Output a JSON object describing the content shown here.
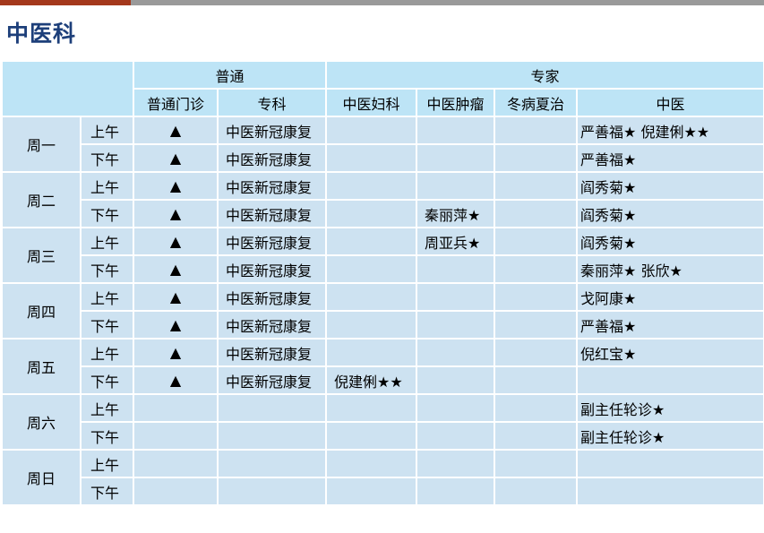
{
  "colors": {
    "accent": "#a4381c",
    "bar": "#9a9a9a",
    "title": "#1d3f7a",
    "header_bg": "#bde4f6",
    "cell_bg": "#cde2f1"
  },
  "title": "中医科",
  "headers": {
    "group_general": "普通",
    "group_expert": "专家",
    "columns": [
      "普通门诊",
      "专科",
      "中医妇科",
      "中医肿瘤",
      "冬病夏治",
      "中医"
    ]
  },
  "days": [
    {
      "name": "周一",
      "slots": [
        {
          "half": "上午",
          "general": "▲",
          "specialty": "中医新冠康复",
          "gyn": "",
          "oncology": "",
          "winter": "",
          "tcm": "严善福★  倪建俐★★"
        },
        {
          "half": "下午",
          "general": "▲",
          "specialty": "中医新冠康复",
          "gyn": "",
          "oncology": "",
          "winter": "",
          "tcm": "严善福★"
        }
      ]
    },
    {
      "name": "周二",
      "slots": [
        {
          "half": "上午",
          "general": "▲",
          "specialty": "中医新冠康复",
          "gyn": "",
          "oncology": "",
          "winter": "",
          "tcm": "阎秀菊★"
        },
        {
          "half": "下午",
          "general": "▲",
          "specialty": "中医新冠康复",
          "gyn": "",
          "oncology": "秦丽萍★",
          "winter": "",
          "tcm": "阎秀菊★"
        }
      ]
    },
    {
      "name": "周三",
      "slots": [
        {
          "half": "上午",
          "general": "▲",
          "specialty": "中医新冠康复",
          "gyn": "",
          "oncology": "周亚兵★",
          "winter": "",
          "tcm": "阎秀菊★"
        },
        {
          "half": "下午",
          "general": "▲",
          "specialty": "中医新冠康复",
          "gyn": "",
          "oncology": "",
          "winter": "",
          "tcm": "秦丽萍★  张欣★"
        }
      ]
    },
    {
      "name": "周四",
      "slots": [
        {
          "half": "上午",
          "general": "▲",
          "specialty": "中医新冠康复",
          "gyn": "",
          "oncology": "",
          "winter": "",
          "tcm": "戈阿康★"
        },
        {
          "half": "下午",
          "general": "▲",
          "specialty": "中医新冠康复",
          "gyn": "",
          "oncology": "",
          "winter": "",
          "tcm": "严善福★"
        }
      ]
    },
    {
      "name": "周五",
      "slots": [
        {
          "half": "上午",
          "general": "▲",
          "specialty": "中医新冠康复",
          "gyn": "",
          "oncology": "",
          "winter": "",
          "tcm": "倪红宝★"
        },
        {
          "half": "下午",
          "general": "▲",
          "specialty": "中医新冠康复",
          "gyn": "倪建俐★★",
          "oncology": "",
          "winter": "",
          "tcm": ""
        }
      ]
    },
    {
      "name": "周六",
      "slots": [
        {
          "half": "上午",
          "general": "",
          "specialty": "",
          "gyn": "",
          "oncology": "",
          "winter": "",
          "tcm": "副主任轮诊★"
        },
        {
          "half": "下午",
          "general": "",
          "specialty": "",
          "gyn": "",
          "oncology": "",
          "winter": "",
          "tcm": "副主任轮诊★"
        }
      ]
    },
    {
      "name": "周日",
      "slots": [
        {
          "half": "上午",
          "general": "",
          "specialty": "",
          "gyn": "",
          "oncology": "",
          "winter": "",
          "tcm": ""
        },
        {
          "half": "下午",
          "general": "",
          "specialty": "",
          "gyn": "",
          "oncology": "",
          "winter": "",
          "tcm": ""
        }
      ]
    }
  ]
}
